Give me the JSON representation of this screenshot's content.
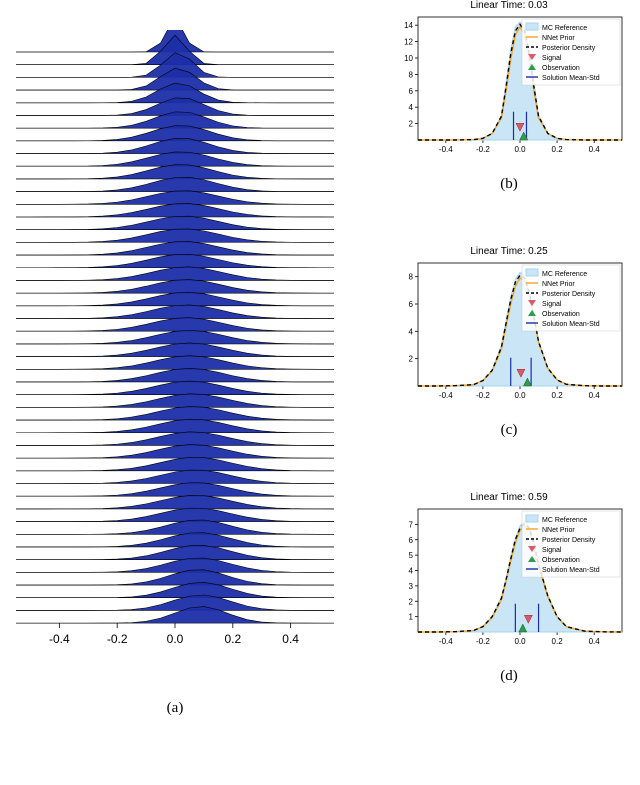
{
  "captions": {
    "a": "(a)",
    "b": "(b)",
    "c": "(c)",
    "d": "(d)"
  },
  "ridge": {
    "xticks": [
      -0.4,
      -0.2,
      0.0,
      0.2,
      0.4
    ],
    "num_rows": 46,
    "x": [
      -0.55,
      -0.5,
      -0.45,
      -0.4,
      -0.35,
      -0.3,
      -0.25,
      -0.2,
      -0.15,
      -0.1,
      -0.05,
      0.0,
      0.05,
      0.1,
      0.15,
      0.2,
      0.25,
      0.3,
      0.35,
      0.4,
      0.45,
      0.5,
      0.55
    ]
  },
  "chart_data": [
    {
      "id": "ridgeline",
      "type": "area",
      "title": "",
      "xlabel": "",
      "ylabel": "",
      "xlim": [
        -0.55,
        0.55
      ],
      "ylim_per_row": [
        0,
        1
      ],
      "x": [
        -0.55,
        -0.5,
        -0.45,
        -0.4,
        -0.35,
        -0.3,
        -0.25,
        -0.2,
        -0.15,
        -0.1,
        -0.05,
        0.0,
        0.05,
        0.1,
        0.15,
        0.2,
        0.25,
        0.3,
        0.35,
        0.4,
        0.45,
        0.5,
        0.55
      ],
      "rows_count": 46,
      "rows_mean": [
        0.0,
        0.0,
        0.01,
        0.01,
        0.01,
        0.02,
        0.02,
        0.02,
        0.02,
        0.02,
        0.02,
        0.03,
        0.03,
        0.03,
        0.03,
        0.03,
        0.03,
        0.03,
        0.04,
        0.04,
        0.04,
        0.04,
        0.04,
        0.05,
        0.05,
        0.05,
        0.05,
        0.05,
        0.06,
        0.06,
        0.06,
        0.06,
        0.06,
        0.07,
        0.07,
        0.07,
        0.07,
        0.07,
        0.08,
        0.08,
        0.08,
        0.08,
        0.08,
        0.09,
        0.09,
        0.09
      ],
      "rows_std": [
        0.03,
        0.04,
        0.05,
        0.06,
        0.07,
        0.08,
        0.09,
        0.1,
        0.1,
        0.11,
        0.11,
        0.11,
        0.12,
        0.12,
        0.12,
        0.12,
        0.12,
        0.12,
        0.12,
        0.12,
        0.12,
        0.12,
        0.12,
        0.12,
        0.12,
        0.12,
        0.12,
        0.12,
        0.12,
        0.12,
        0.12,
        0.12,
        0.12,
        0.12,
        0.12,
        0.12,
        0.12,
        0.12,
        0.11,
        0.11,
        0.11,
        0.11,
        0.1,
        0.1,
        0.1,
        0.09
      ],
      "xticks": [
        -0.4,
        -0.2,
        0.0,
        0.2,
        0.4
      ]
    },
    {
      "id": "panel-b",
      "type": "line",
      "title": "Linear Time: 0.03",
      "xlabel": "",
      "ylabel": "",
      "xlim": [
        -0.55,
        0.55
      ],
      "ylim": [
        0,
        15
      ],
      "xticks": [
        -0.4,
        -0.2,
        0.0,
        0.2,
        0.4
      ],
      "yticks": [
        2,
        4,
        6,
        8,
        10,
        12,
        14
      ],
      "signal": 0.0,
      "observation": 0.02,
      "mean_std_lo": -0.035,
      "mean_std_hi": 0.035,
      "x": [
        -0.55,
        -0.45,
        -0.35,
        -0.25,
        -0.2,
        -0.15,
        -0.1,
        -0.075,
        -0.05,
        -0.025,
        0.0,
        0.025,
        0.05,
        0.075,
        0.1,
        0.15,
        0.2,
        0.25,
        0.35,
        0.45,
        0.55
      ],
      "series": [
        {
          "name": "MC Reference",
          "color": "#a6d3ee",
          "style": "area",
          "values": [
            0,
            0,
            0,
            0.05,
            0.2,
            0.8,
            3.0,
            7.0,
            11.0,
            13.8,
            14.4,
            13.8,
            11.0,
            7.0,
            3.0,
            0.8,
            0.2,
            0.05,
            0,
            0,
            0
          ]
        },
        {
          "name": "NNet Prior",
          "color": "#f5a623",
          "style": "line",
          "values": [
            0,
            0,
            0,
            0.05,
            0.2,
            0.8,
            2.7,
            6.0,
            9.8,
            12.8,
            13.8,
            12.8,
            9.8,
            6.0,
            2.7,
            0.8,
            0.2,
            0.05,
            0,
            0,
            0
          ]
        },
        {
          "name": "Posterior Density",
          "color": "#000000",
          "style": "dash",
          "values": [
            0,
            0,
            0,
            0.05,
            0.2,
            0.8,
            2.9,
            6.5,
            10.5,
            13.3,
            14.1,
            13.3,
            10.5,
            6.5,
            2.9,
            0.8,
            0.2,
            0.05,
            0,
            0,
            0
          ]
        }
      ]
    },
    {
      "id": "panel-c",
      "type": "line",
      "title": "Linear Time: 0.25",
      "xlabel": "",
      "ylabel": "",
      "xlim": [
        -0.55,
        0.55
      ],
      "ylim": [
        0,
        9
      ],
      "xticks": [
        -0.4,
        -0.2,
        0.0,
        0.2,
        0.4
      ],
      "yticks": [
        2,
        4,
        6,
        8
      ],
      "signal": 0.005,
      "observation": 0.04,
      "mean_std_lo": -0.05,
      "mean_std_hi": 0.06,
      "x": [
        -0.55,
        -0.45,
        -0.35,
        -0.25,
        -0.2,
        -0.15,
        -0.1,
        -0.075,
        -0.05,
        -0.025,
        0.0,
        0.025,
        0.05,
        0.075,
        0.1,
        0.15,
        0.2,
        0.25,
        0.35,
        0.45,
        0.55
      ],
      "series": [
        {
          "name": "MC Reference",
          "color": "#a6d3ee",
          "style": "area",
          "values": [
            0,
            0,
            0.02,
            0.1,
            0.4,
            1.2,
            3.0,
            4.8,
            6.5,
            7.8,
            8.3,
            8.1,
            7.0,
            5.2,
            3.3,
            1.3,
            0.45,
            0.12,
            0.02,
            0,
            0
          ]
        },
        {
          "name": "NNet Prior",
          "color": "#f5a623",
          "style": "line",
          "values": [
            0,
            0,
            0.02,
            0.1,
            0.4,
            1.1,
            2.7,
            4.4,
            6.0,
            7.3,
            7.9,
            7.7,
            6.7,
            5.0,
            3.2,
            1.3,
            0.45,
            0.12,
            0.02,
            0,
            0
          ]
        },
        {
          "name": "Posterior Density",
          "color": "#000000",
          "style": "dash",
          "values": [
            0,
            0,
            0.02,
            0.1,
            0.4,
            1.15,
            2.85,
            4.6,
            6.3,
            7.6,
            8.1,
            7.9,
            6.85,
            5.1,
            3.25,
            1.3,
            0.45,
            0.12,
            0.02,
            0,
            0
          ]
        }
      ]
    },
    {
      "id": "panel-d",
      "type": "line",
      "title": "Linear Time: 0.59",
      "xlabel": "",
      "ylabel": "",
      "xlim": [
        -0.55,
        0.55
      ],
      "ylim": [
        0,
        8
      ],
      "xticks": [
        -0.4,
        -0.2,
        0.0,
        0.2,
        0.4
      ],
      "yticks": [
        1,
        2,
        3,
        4,
        5,
        6,
        7
      ],
      "signal": 0.045,
      "observation": 0.015,
      "mean_std_lo": -0.025,
      "mean_std_hi": 0.1,
      "x": [
        -0.55,
        -0.45,
        -0.35,
        -0.25,
        -0.2,
        -0.15,
        -0.1,
        -0.075,
        -0.05,
        -0.025,
        0.0,
        0.025,
        0.05,
        0.075,
        0.1,
        0.15,
        0.2,
        0.25,
        0.35,
        0.45,
        0.55
      ],
      "series": [
        {
          "name": "MC Reference",
          "color": "#a6d3ee",
          "style": "area",
          "values": [
            0,
            0,
            0.02,
            0.1,
            0.35,
            1.0,
            2.3,
            3.5,
            4.9,
            6.1,
            6.9,
            7.2,
            6.9,
            5.9,
            4.5,
            2.4,
            1.0,
            0.35,
            0.05,
            0.01,
            0
          ]
        },
        {
          "name": "NNet Prior",
          "color": "#f5a623",
          "style": "line",
          "values": [
            0,
            0,
            0.02,
            0.1,
            0.35,
            0.95,
            2.1,
            3.3,
            4.6,
            5.8,
            6.6,
            6.9,
            6.6,
            5.6,
            4.3,
            2.3,
            1.0,
            0.35,
            0.05,
            0.01,
            0
          ]
        },
        {
          "name": "Posterior Density",
          "color": "#000000",
          "style": "dash",
          "values": [
            0,
            0,
            0.02,
            0.1,
            0.35,
            1.0,
            2.2,
            3.4,
            4.75,
            6.0,
            6.75,
            7.05,
            6.75,
            5.75,
            4.4,
            2.35,
            1.0,
            0.35,
            0.05,
            0.01,
            0
          ]
        }
      ]
    }
  ],
  "legend": [
    "MC Reference",
    "NNet Prior",
    "Posterior Density",
    "Signal",
    "Observation",
    "Solution Mean-Std"
  ]
}
